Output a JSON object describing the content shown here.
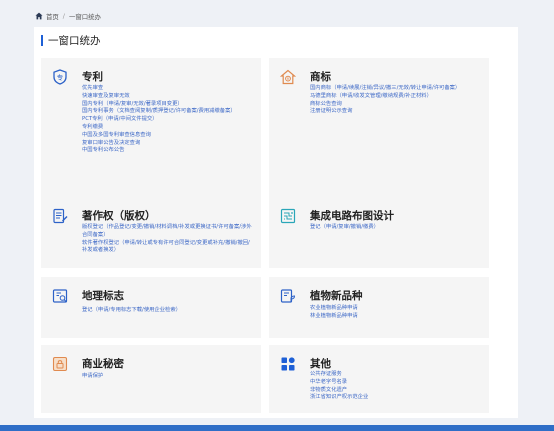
{
  "breadcrumb": {
    "home": "首页",
    "separator": "/",
    "current": "一窗口统办"
  },
  "page": {
    "title": "一窗口统办"
  },
  "colors": {
    "accent": "#1e60d6",
    "link": "#3b67c6",
    "bottom_bar": "#2f6ec7"
  },
  "cards": {
    "patent": {
      "icon": "patent-shield-icon",
      "title": "专利",
      "items": [
        "优先审查",
        "快速审查及复审无效",
        "国内专利（申请/复审/无效/著录项目变更）",
        "国内专利事务（文档查阅复制/质押登记/许可备案/费用减缴备案）",
        "PCT专利（申请/中间文件提交）",
        "专利缴费",
        "中国及多国专利审查信息查询",
        "复审口审公告及决定查询",
        "中国专利公布公告"
      ]
    },
    "trademark": {
      "icon": "trademark-house-icon",
      "title": "商标",
      "items": [
        "国内商标（申请/续展/注销/异议/撤三/无效/转让申请/许可备案）",
        "马德里商标（申请/收发文管理/缴纳规费/补正材料）",
        "商标公告查询",
        "注册证明公示查询"
      ]
    },
    "copyright": {
      "icon": "copyright-document-icon",
      "title": "著作权（版权）",
      "items": [
        "版权登记（作品登记/变更/撤销/材料调档/补发或更换证书/许可备案/涉外合同备案）",
        "软件著作权登记（申请/转让或专有许可合同登记/变更或补充/撤销/撤回/补发或者换发）"
      ]
    },
    "ic": {
      "icon": "circuit-layout-icon",
      "title": "集成电路布图设计",
      "items": [
        "登记（申请/复审/撤销/缴费）"
      ]
    },
    "geo": {
      "icon": "geographic-indication-icon",
      "title": "地理标志",
      "items": [
        "登记（申请/专用标志下载/使用企业检索）"
      ]
    },
    "plant": {
      "icon": "plant-variety-icon",
      "title": "植物新品种",
      "items": [
        "农业植物新品种申请",
        "林业植物新品种申请"
      ]
    },
    "secret": {
      "icon": "trade-secret-icon",
      "title": "商业秘密",
      "items": [
        "申请保护"
      ]
    },
    "other": {
      "icon": "grid-apps-icon",
      "title": "其他",
      "items": [
        "公共存证服务",
        "中华老字号名录",
        "非物质文化遗产",
        "浙江省知识产权示范企业"
      ]
    }
  }
}
